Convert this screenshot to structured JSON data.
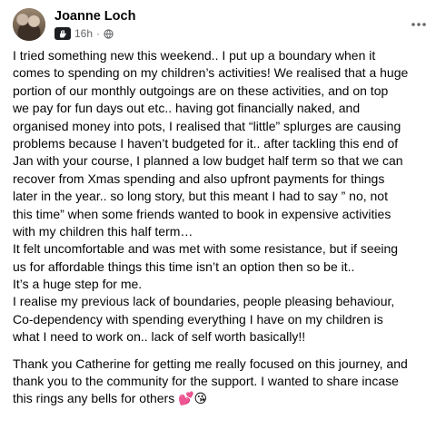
{
  "post": {
    "author_name": "Joanne Loch",
    "timestamp": "16h",
    "separator": "·",
    "badge_icon": "hand-wave-icon",
    "privacy_icon": "globe-icon",
    "more_icon": "more-options-icon",
    "paragraph1": [
      "I tried something new this weekend.. I put up a boundary when it",
      "comes to spending on my children’s activities! We realised that a huge",
      "portion of our monthly outgoings are on these activities, and on top",
      "we pay for fun days out etc.. having got financially naked, and",
      "organised money into pots, I realised that “little” splurges are causing",
      "problems because I haven’t budgeted for it.. after tackling this end of",
      "Jan with your course, I planned a low budget half term so that we can",
      "recover from Xmas spending and also upfront payments for things",
      "later in the year.. so long story, but this meant I had to say ” no, not",
      "this time” when some friends wanted to book in expensive activities",
      "with my children this half term…",
      "It felt uncomfortable and was met with some resistance, but if seeing",
      "us for affordable things this time isn’t an option then so be it..",
      "It’s a huge step for me.",
      "I realise my previous lack of boundaries, people pleasing behaviour,",
      "Co-dependency with spending everything I have on my children is",
      "what I need to work on.. lack of self worth basically!!"
    ],
    "paragraph2": [
      "Thank you Catherine for getting me really focused on this journey, and",
      "thank you to the community for the support. I wanted to share incase",
      "this rings any bells for others 💕😘"
    ]
  }
}
